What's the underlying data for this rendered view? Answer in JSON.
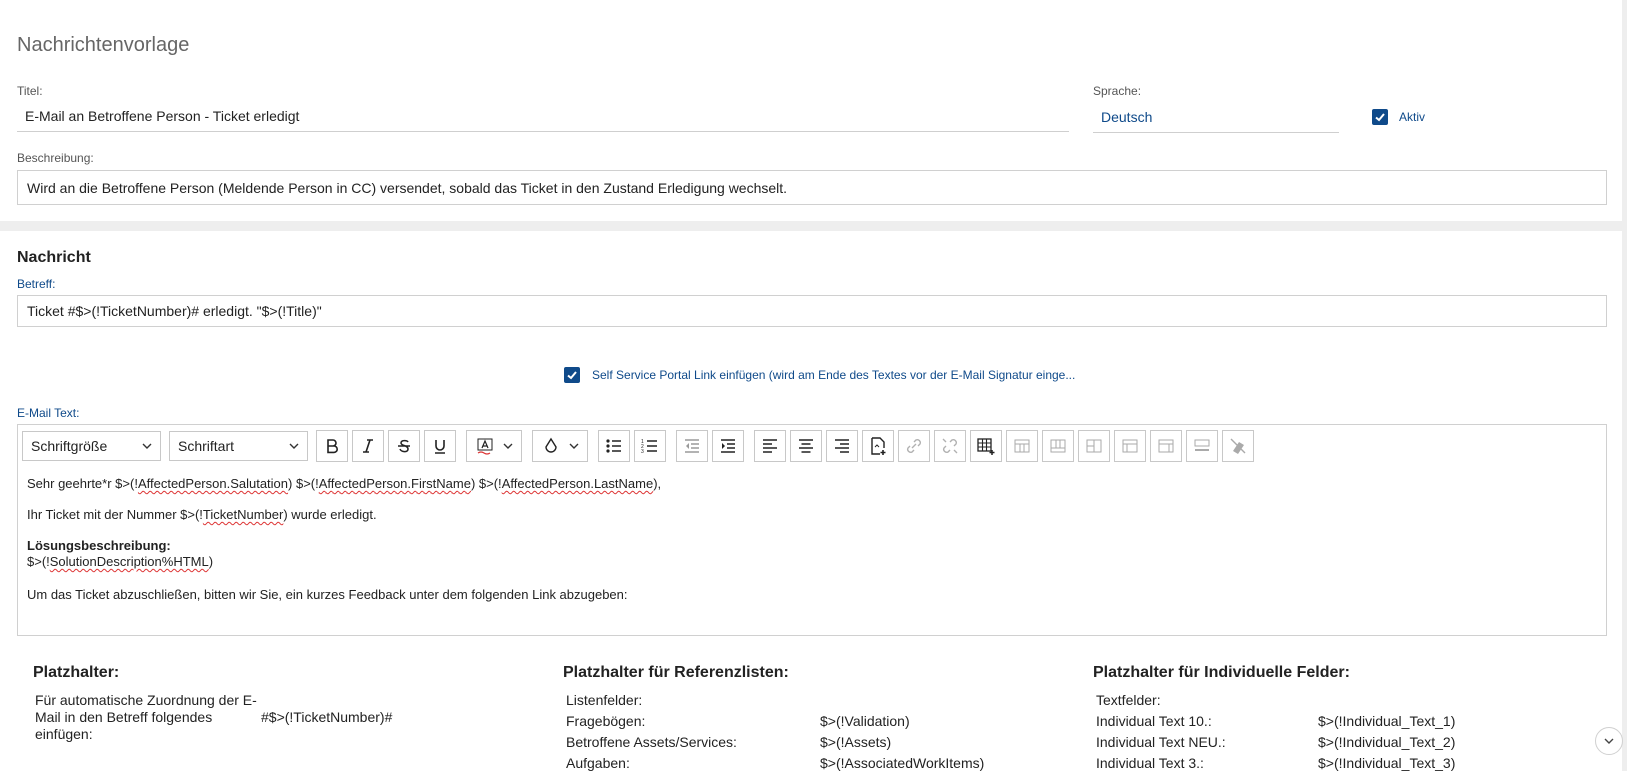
{
  "template": {
    "page_title": "Nachrichtenvorlage",
    "title_label": "Titel:",
    "title_value": "E-Mail an Betroffene Person - Ticket erledigt",
    "language_label": "Sprache:",
    "language_value": "Deutsch",
    "active_label": "Aktiv",
    "active_checked": true,
    "description_label": "Beschreibung:",
    "description_value": "Wird an die Betroffene Person (Meldende Person in CC) versendet, sobald das Ticket in den Zustand Erledigung wechselt."
  },
  "message": {
    "section_title": "Nachricht",
    "subject_label": "Betreff:",
    "subject_value": "Ticket #$>(!TicketNumber)# erledigt. \"$>(!Title)\"",
    "portal_link_label": "Self Service Portal Link einfügen (wird am Ende des Textes vor der E-Mail Signatur einge...",
    "portal_link_checked": true,
    "email_text_label": "E-Mail Text:"
  },
  "toolbar": {
    "font_size": "Schriftgröße",
    "font_family": "Schriftart"
  },
  "editor": {
    "line1": {
      "a": "Sehr geehrte*r $>(!",
      "b": "AffectedPerson.Salutation",
      "c": ") $>(!",
      "d": "AffectedPerson.FirstName",
      "e": ") $>(!",
      "f": "AffectedPerson.LastName",
      "g": "),"
    },
    "line2": {
      "a": "Ihr Ticket mit der Nummer $>(!",
      "b": "TicketNumber",
      "c": ") wurde erledigt."
    },
    "line3": "Lösungsbeschreibung:",
    "line4": {
      "a": "$>(!",
      "b": "SolutionDescription%HTML",
      "c": ")"
    },
    "line5": "Um das Ticket abzuschließen, bitten wir Sie, ein kurzes Feedback unter dem folgenden Link abzugeben:"
  },
  "placeholders": {
    "title": "Platzhalter:",
    "auto_assign_l1": "Für automatische Zuordnung der E-",
    "auto_assign_l2": "Mail in den Betreff folgendes",
    "auto_assign_l3": "einfügen:",
    "auto_assign_value": "#$>(!TicketNumber)#"
  },
  "reference_placeholders": {
    "title": "Platzhalter für Referenzlisten:",
    "rows": [
      {
        "label": "Listenfelder:",
        "value": ""
      },
      {
        "label": "Fragebögen:",
        "value": "$>(!Validation)"
      },
      {
        "label": "Betroffene Assets/Services:",
        "value": "$>(!Assets)"
      },
      {
        "label": "Aufgaben:",
        "value": "$>(!AssociatedWorkItems)"
      }
    ]
  },
  "custom_placeholders": {
    "title": "Platzhalter für Individuelle Felder:",
    "rows": [
      {
        "label": "Textfelder:",
        "value": ""
      },
      {
        "label": "Individual Text 10.:",
        "value": "$>(!Individual_Text_1)"
      },
      {
        "label": "Individual Text NEU.:",
        "value": "$>(!Individual_Text_2)"
      },
      {
        "label": "Individual Text 3.:",
        "value": "$>(!Individual_Text_3)"
      }
    ]
  },
  "colors": {
    "accent": "#0f4a8a",
    "border": "#d0d0d0",
    "background": "#eeeeee"
  }
}
